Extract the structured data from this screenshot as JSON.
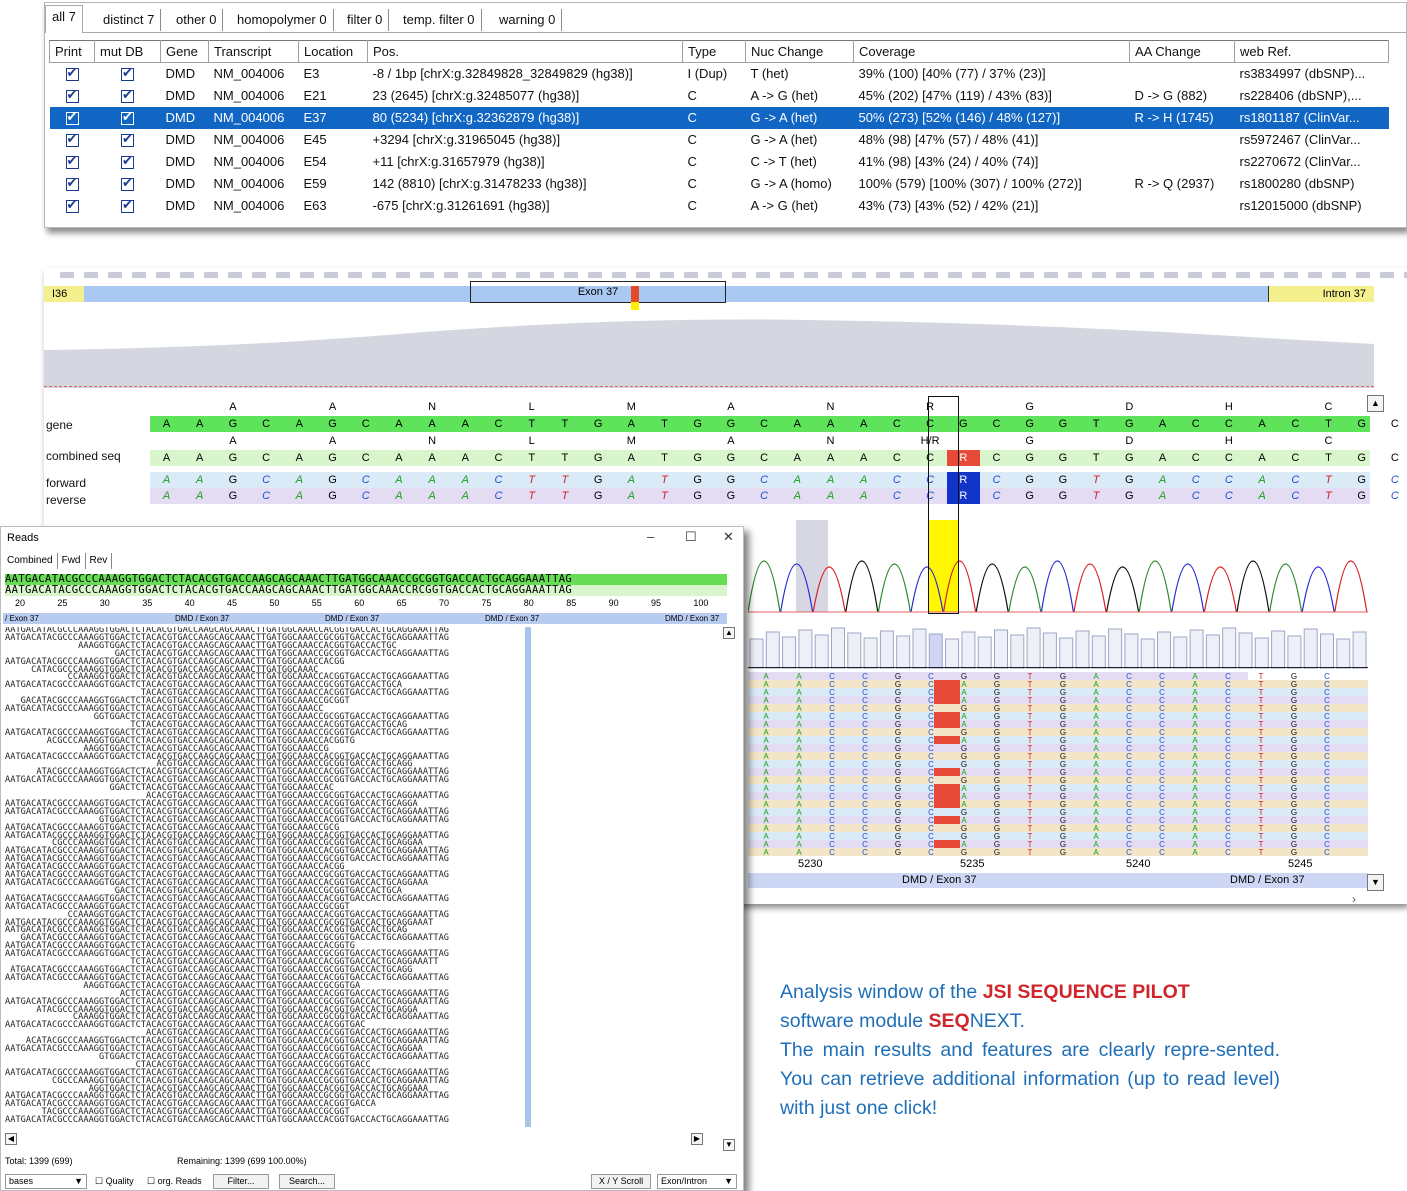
{
  "tabs": [
    "all 7",
    "distinct 7",
    "other 0",
    "homopolymer 0",
    "filter 0",
    "temp. filter 0",
    "warning 0"
  ],
  "columns": [
    "Print",
    "mut DB",
    "Gene",
    "Transcript",
    "Location",
    "Pos.",
    "Type",
    "Nuc Change",
    "Coverage",
    "AA Change",
    "web Ref."
  ],
  "rows": [
    {
      "gene": "DMD",
      "transcript": "NM_004006",
      "location": "E3",
      "pos": "-8 / 1bp   [chrX:g.32849828_32849829 (hg38)]",
      "type": "I (Dup)",
      "nuc": "T (het)",
      "coverage": "39% (100)   [40% (77) / 37% (23)]",
      "aa": "",
      "ref": "rs3834997 (dbSNP)..."
    },
    {
      "gene": "DMD",
      "transcript": "NM_004006",
      "location": "E21",
      "pos": "23 (2645)   [chrX:g.32485077 (hg38)]",
      "type": "C",
      "nuc": "A -> G (het)",
      "coverage": "45% (202)   [47% (119) / 43% (83)]",
      "aa": "D -> G (882)",
      "ref": "rs228406 (dbSNP),..."
    },
    {
      "gene": "DMD",
      "transcript": "NM_004006",
      "location": "E37",
      "pos": "80 (5234)   [chrX:g.32362879 (hg38)]",
      "type": "C",
      "nuc": "G -> A (het)",
      "coverage": "50% (273)   [52% (146) / 48% (127)]",
      "aa": "R -> H (1745)",
      "ref": "rs1801187 (ClinVar..."
    },
    {
      "gene": "DMD",
      "transcript": "NM_004006",
      "location": "E45",
      "pos": "+3294   [chrX:g.31965045 (hg38)]",
      "type": "C",
      "nuc": "G -> A (het)",
      "coverage": "48% (98)   [47% (57) / 48% (41)]",
      "aa": "",
      "ref": "rs5972467 (ClinVar..."
    },
    {
      "gene": "DMD",
      "transcript": "NM_004006",
      "location": "E54",
      "pos": "+11   [chrX:g.31657979 (hg38)]",
      "type": "C",
      "nuc": "C -> T (het)",
      "coverage": "41% (98)   [43% (24) / 40% (74)]",
      "aa": "",
      "ref": "rs2270672 (ClinVar..."
    },
    {
      "gene": "DMD",
      "transcript": "NM_004006",
      "location": "E59",
      "pos": "142 (8810)   [chrX:g.31478233 (hg38)]",
      "type": "C",
      "nuc": "G -> A (homo)",
      "coverage": "100% (579)   [100% (307) / 100% (272)]",
      "aa": "R -> Q (2937)",
      "ref": "rs1800280 (dbSNP)"
    },
    {
      "gene": "DMD",
      "transcript": "NM_004006",
      "location": "E63",
      "pos": "-675   [chrX:g.31261691 (hg38)]",
      "type": "C",
      "nuc": "A -> G (het)",
      "coverage": "43% (73)   [43% (52) / 42% (21)]",
      "aa": "",
      "ref": "rs12015000 (dbSNP)"
    }
  ],
  "selected_row": 2,
  "viewer": {
    "intron_left": "I36",
    "exon": "Exon 37",
    "intron_right": "Intron 37",
    "track_labels": [
      "gene",
      "combined seq",
      "forward",
      "reverse"
    ],
    "aa_gene": [
      "A",
      "",
      "",
      "A",
      "",
      "",
      "N",
      "",
      "",
      "L",
      "",
      "",
      "M",
      "",
      "",
      "A",
      "",
      "",
      "N",
      "",
      "",
      "R",
      "",
      "",
      "G",
      "",
      "",
      "D",
      "",
      "",
      "H",
      "",
      "",
      "C"
    ],
    "aa_combined": [
      "A",
      "",
      "",
      "A",
      "",
      "",
      "N",
      "",
      "",
      "L",
      "",
      "",
      "M",
      "",
      "",
      "A",
      "",
      "",
      "N",
      "",
      "",
      "H/R",
      "",
      "",
      "G",
      "",
      "",
      "D",
      "",
      "",
      "H",
      "",
      "",
      "C"
    ],
    "gene_seq": "AAGCAGCAAACTTGATGGCAAACCGCGGTGACCACTGC",
    "combined_seq": "AAGCAGCAAACTTGATGGCAAACCRCGGTGACCACTGC",
    "forward_seq": "AAGCAGCAAACTTGATGGCAAACCRCGGTGACCACTGC",
    "reverse_seq": "AAGCAGCAAACTTGATGGCAAACCRCGGTGACCACTGC",
    "positions": [
      "5230",
      "5235",
      "5240",
      "5245"
    ],
    "exon_bar": [
      "DMD / Exon 37",
      "DMD / Exon 37"
    ]
  },
  "reads": {
    "title": "Reads",
    "tabs": [
      "Combined",
      "Fwd",
      "Rev"
    ],
    "reference": "AATGACATACGCCCAAAGGTGGACTCTACACGTGACCAAGCAGCAAACTTGATGGCAAACCGCGGTGACCACTGCAGGAAATTAG",
    "consensus": "AATGACATACGCCCAAAGGTGGACTCTACACGTGACCAAGCAGCAAACTTGATGGCAAACCRCGGTGACCACTGCAGGAAATTAG",
    "ruler": [
      "20",
      "25",
      "30",
      "35",
      "40",
      "45",
      "50",
      "55",
      "60",
      "65",
      "70",
      "75",
      "80",
      "85",
      "90",
      "95",
      "100"
    ],
    "exon_labels": [
      "/ Exon 37",
      "DMD / Exon 37",
      "DMD / Exon 37",
      "DMD / Exon 37",
      "DMD / Exon 37"
    ],
    "total": "Total: 1399 (699)",
    "remaining": "Remaining: 1399 (699  100.00%)",
    "toolbar": {
      "mode": "bases",
      "quality": "Quality",
      "org_reads": "org. Reads",
      "filter": "Filter...",
      "search": "Search...",
      "xy": "X / Y Scroll",
      "exon": "Exon/Intron"
    }
  },
  "caption": {
    "line1a": "Analysis window of the ",
    "brand1": "JSI SEQ",
    "brand1b": "UENCE PILOT",
    "line2a": "software module ",
    "brand2": "SEQ",
    "brand2b": "NEXT",
    "body": "The main results and features are clearly repre-sented. You can retrieve additional information (up to read level) with just one click!"
  }
}
